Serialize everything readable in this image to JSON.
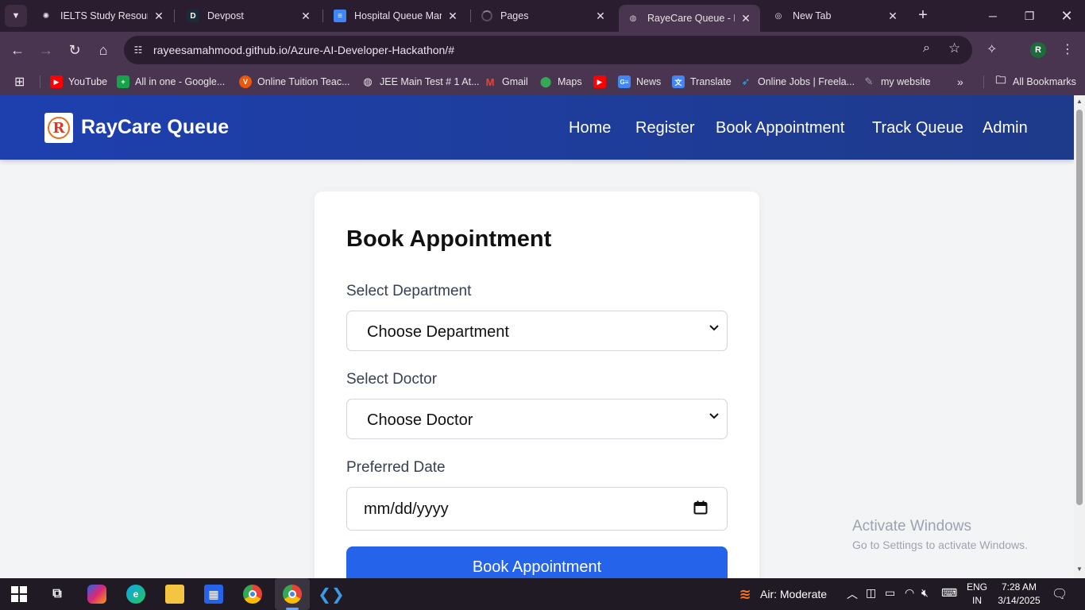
{
  "browser": {
    "tabs": [
      {
        "label": "IELTS Study Resources",
        "favicon": "openai-icon"
      },
      {
        "label": "Devpost",
        "favicon": "devpost-icon"
      },
      {
        "label": "Hospital Queue Mana",
        "favicon": "docs-icon"
      },
      {
        "label": "Pages",
        "favicon": "loading-icon"
      },
      {
        "label": "RayeCare Queue - Ho",
        "favicon": "globe-icon"
      },
      {
        "label": "New Tab",
        "favicon": "chrome-icon"
      }
    ],
    "active_tab_index": 4,
    "address": "rayeesamahmood.github.io/Azure-AI-Developer-Hackathon/#",
    "profile_initial": "R",
    "bookmarks": [
      {
        "label": "YouTube",
        "icon": "youtube-icon",
        "color": "#ff0000"
      },
      {
        "label": "All in one - Google...",
        "icon": "sheets-icon",
        "color": "#16a34a"
      },
      {
        "label": "Online Tuition Teac...",
        "icon": "v-logo-icon",
        "color": "#ea580c"
      },
      {
        "label": "JEE Main Test # 1 At...",
        "icon": "globe-icon",
        "color": "#6b7280"
      },
      {
        "label": "Gmail",
        "icon": "gmail-icon",
        "color": "#ea4335"
      },
      {
        "label": "Maps",
        "icon": "maps-icon",
        "color": "#34a853"
      },
      {
        "label": "",
        "icon": "youtube-icon",
        "color": "#ff0000"
      },
      {
        "label": "News",
        "icon": "news-icon",
        "color": "#4285f4"
      },
      {
        "label": "Translate",
        "icon": "translate-icon",
        "color": "#4285f4"
      },
      {
        "label": "Online Jobs | Freela...",
        "icon": "freelancer-icon",
        "color": "#29b2fe"
      },
      {
        "label": "my website",
        "icon": "wordpress-icon",
        "color": "#6b7280"
      }
    ],
    "all_bookmarks_label": "All Bookmarks"
  },
  "site": {
    "brand": "RayCare Queue",
    "nav": [
      "Home",
      "Register",
      "Book Appointment",
      "Track Queue",
      "Admin"
    ]
  },
  "form": {
    "title": "Book Appointment",
    "department_label": "Select Department",
    "department_value": "Choose Department",
    "doctor_label": "Select Doctor",
    "doctor_value": "Choose Doctor",
    "date_label": "Preferred Date",
    "date_placeholder": "mm/dd/yyyy",
    "submit_label": "Book Appointment"
  },
  "watermark": {
    "line1": "Activate Windows",
    "line2": "Go to Settings to activate Windows."
  },
  "taskbar": {
    "weather": "Air: Moderate",
    "lang_top": "ENG",
    "lang_bottom": "IN",
    "time": "7:28 AM",
    "date": "3/14/2025"
  },
  "colors": {
    "header": "#1e40af",
    "primary_button": "#2563eb",
    "page_bg": "#f3f4f6"
  }
}
